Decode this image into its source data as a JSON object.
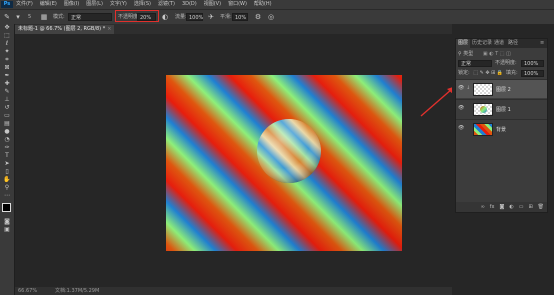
{
  "app": {
    "logo": "Ps"
  },
  "menu": [
    "文件(F)",
    "编辑(E)",
    "图像(I)",
    "图层(L)",
    "文字(Y)",
    "选择(S)",
    "滤镜(T)",
    "3D(D)",
    "视图(V)",
    "窗口(W)",
    "帮助(H)"
  ],
  "options": {
    "brush_size": "5",
    "mode_label": "模式:",
    "mode_value": "正常",
    "opacity_label": "不透明度:",
    "opacity_value": "20%",
    "flow_label": "流量:",
    "flow_value": "100%",
    "smooth_label": "平滑:",
    "smooth_value": "10%"
  },
  "tabs": [
    {
      "label": "未标题-1 @ 66.7% (图层 2, RGB/8) *",
      "close": "×"
    }
  ],
  "status": {
    "zoom": "66.67%",
    "doc": "文档:1.37M/5.29M"
  },
  "layers_panel": {
    "tabs": [
      "图层",
      "历史记录",
      "通道",
      "路径"
    ],
    "kind_label": "类型",
    "blend_mode": "正常",
    "opacity_label": "不透明度:",
    "opacity_value": "100%",
    "lock_label": "锁定:",
    "fill_label": "填充:",
    "fill_value": "100%",
    "layers": [
      {
        "name": "图层 2",
        "selected": true
      },
      {
        "name": "图层 1",
        "selected": false
      },
      {
        "name": "背景",
        "selected": false
      }
    ]
  },
  "colors": {
    "stripe_orange": "#e0560e",
    "stripe_green": "#8ef07a",
    "stripe_blue": "#1e7fd4",
    "stripe_red": "#e81c0c",
    "annotation_red": "#e0302c"
  }
}
